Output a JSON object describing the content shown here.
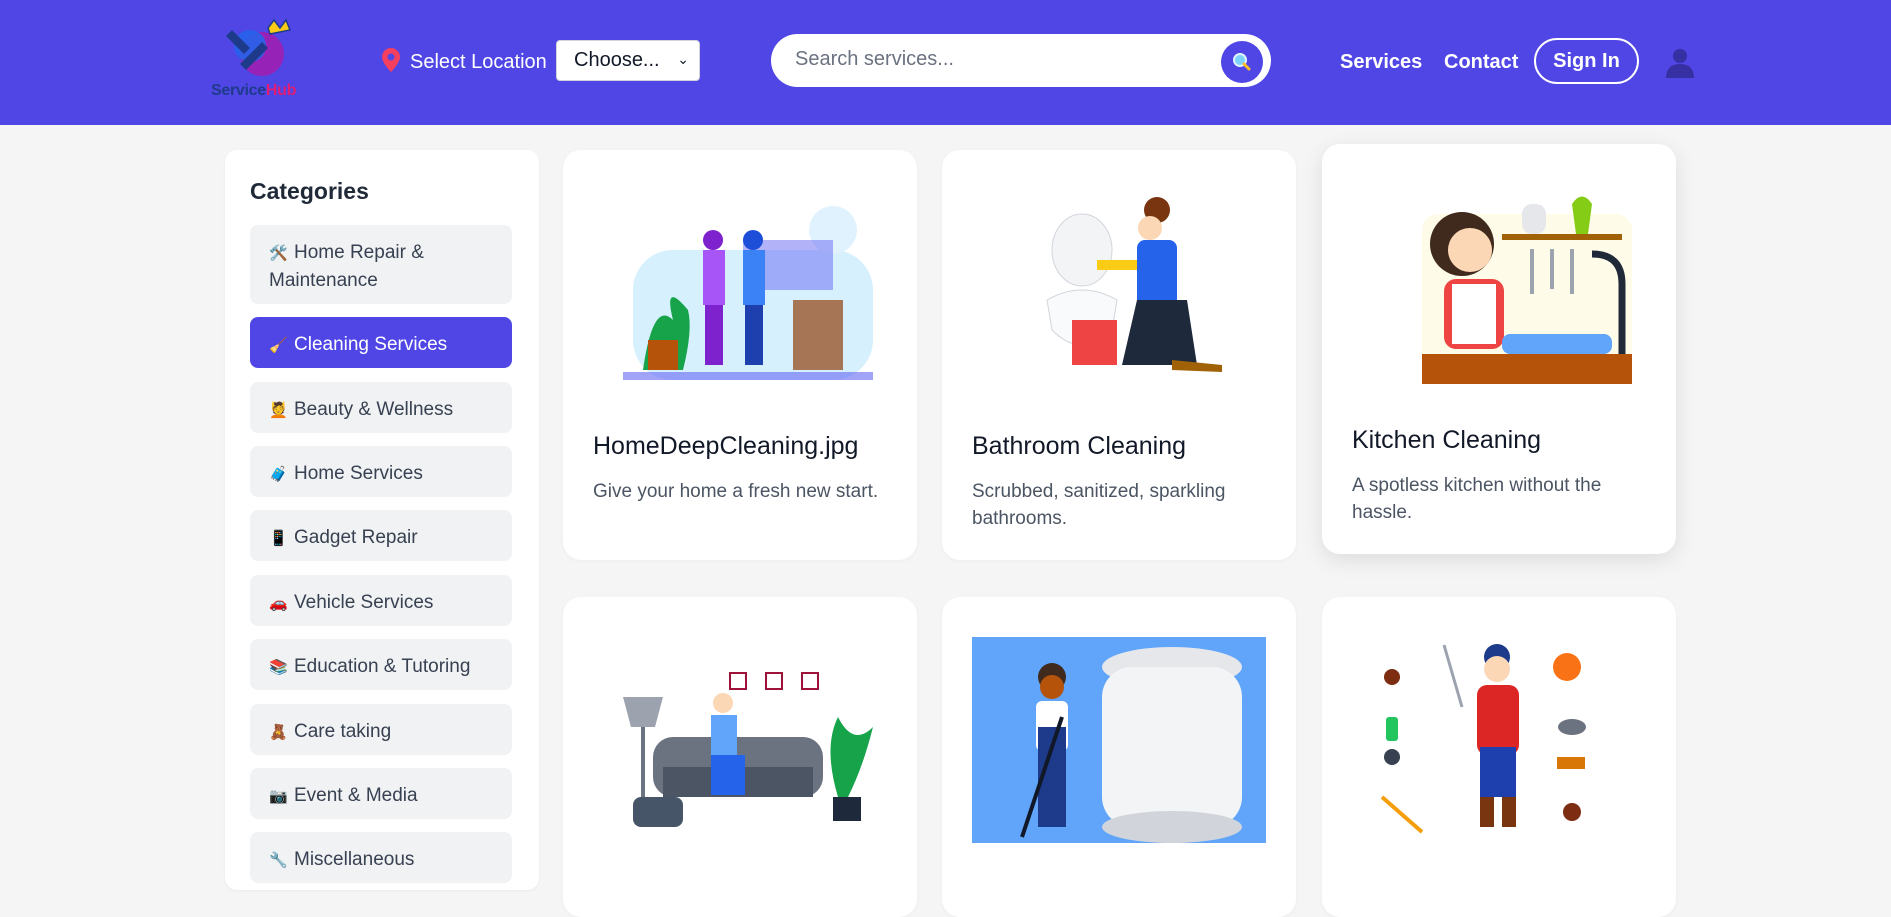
{
  "brand": {
    "name_part1": "Service",
    "name_part2": "Hub"
  },
  "header": {
    "location_label": "Select Location",
    "location_select_value": "Choose...",
    "search_placeholder": "Search services...",
    "nav": {
      "services": "Services",
      "contact": "Contact",
      "signin": "Sign In"
    }
  },
  "sidebar": {
    "title": "Categories",
    "items": [
      {
        "icon": "🛠️",
        "label": "Home Repair & Maintenance"
      },
      {
        "icon": "🧹",
        "label": "Cleaning Services"
      },
      {
        "icon": "💆",
        "label": "Beauty & Wellness"
      },
      {
        "icon": "🧳",
        "label": "Home Services"
      },
      {
        "icon": "📱",
        "label": "Gadget Repair"
      },
      {
        "icon": "🚗",
        "label": "Vehicle Services"
      },
      {
        "icon": "📚",
        "label": "Education & Tutoring"
      },
      {
        "icon": "🧸",
        "label": "Care taking"
      },
      {
        "icon": "📷",
        "label": "Event & Media"
      },
      {
        "icon": "🔧",
        "label": "Miscellaneous"
      }
    ]
  },
  "cards": [
    {
      "title": "HomeDeepCleaning.jpg",
      "desc": "Give your home a fresh new start."
    },
    {
      "title": "Bathroom Cleaning",
      "desc": "Scrubbed, sanitized, sparkling bathrooms."
    },
    {
      "title": "Kitchen Cleaning",
      "desc": "A spotless kitchen without the hassle."
    }
  ],
  "colors": {
    "primary": "#4f46e5",
    "background": "#f5f5f6",
    "card": "#ffffff"
  }
}
